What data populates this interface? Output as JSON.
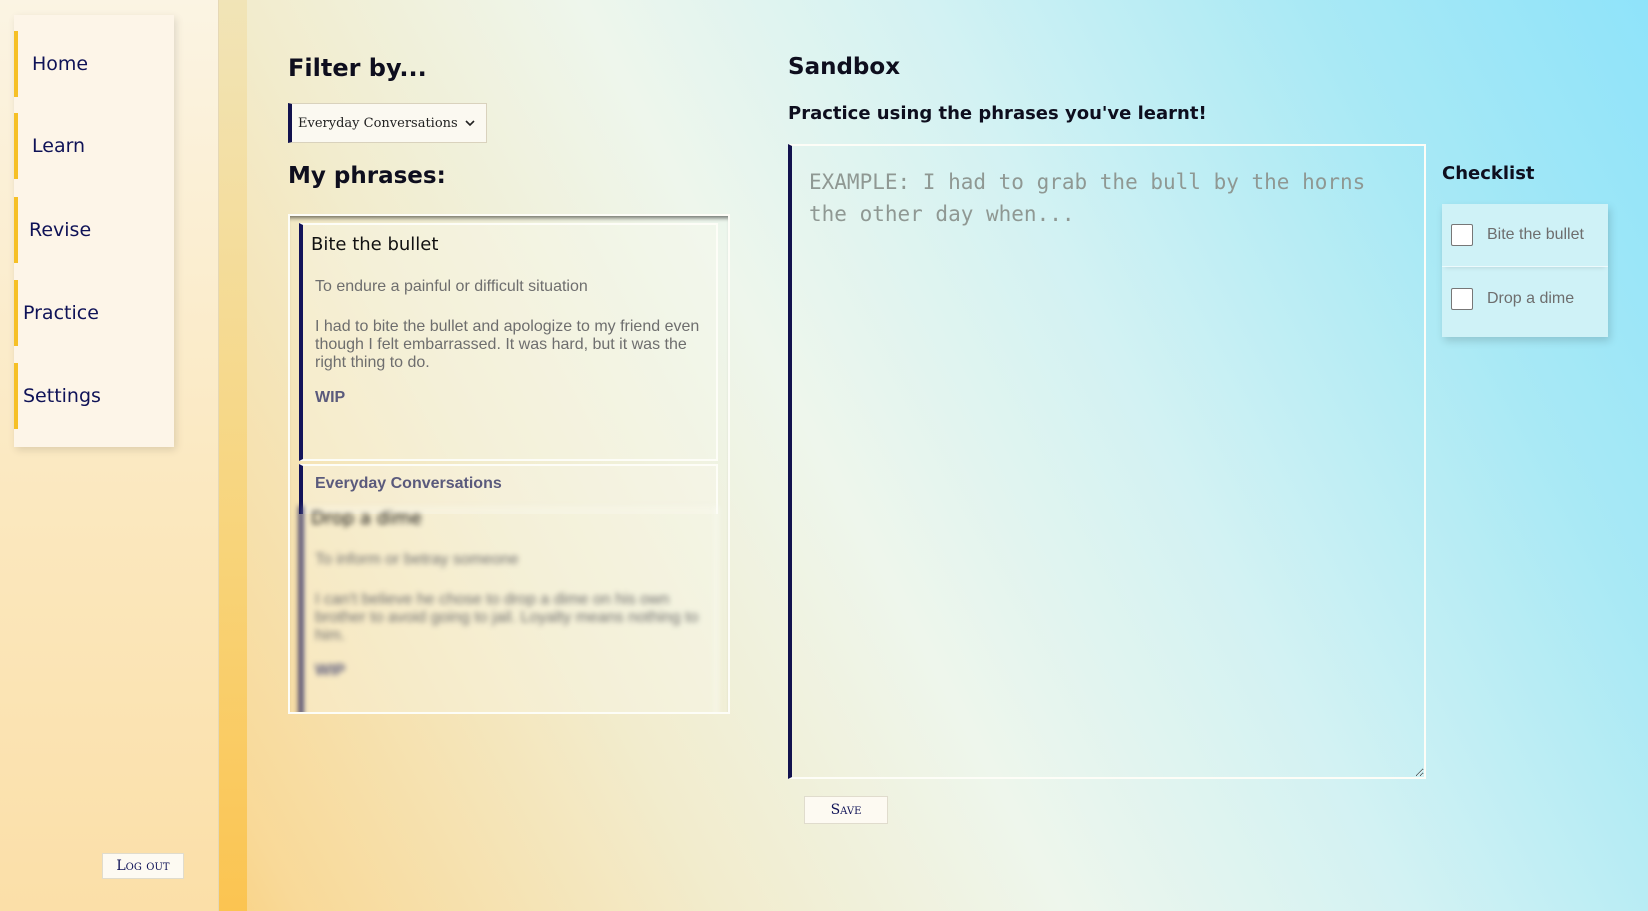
{
  "nav": {
    "items": [
      {
        "label": "Home"
      },
      {
        "label": "Learn"
      },
      {
        "label": "Revise"
      },
      {
        "label": "Practice"
      },
      {
        "label": "Settings"
      }
    ],
    "logout_label": "Log out"
  },
  "filter": {
    "heading": "Filter by...",
    "selected": "Everyday Conversations"
  },
  "phrases": {
    "heading": "My phrases:",
    "items": [
      {
        "title": "Bite the bullet",
        "definition": "To endure a painful or difficult situation",
        "example": "I had to bite the bullet and apologize to my friend even though I felt embarrassed. It was hard, but it was the right thing to do.",
        "status": "WIP",
        "category": "Everyday Conversations"
      },
      {
        "title": "Drop a dime",
        "definition": "To inform or betray someone",
        "example": "I can't believe he chose to drop a dime on his own brother to avoid going to jail. Loyalty means nothing to him.",
        "status": "WIP"
      }
    ]
  },
  "sandbox": {
    "heading": "Sandbox",
    "subheading": "Practice using the phrases you've learnt!",
    "placeholder": "EXAMPLE: I had to grab the bull by the horns the other day when...",
    "value": "",
    "save_label": "Save"
  },
  "checklist": {
    "heading": "Checklist",
    "items": [
      {
        "label": "Bite the bullet",
        "checked": false
      },
      {
        "label": "Drop a dime",
        "checked": false
      }
    ]
  },
  "colors": {
    "accent_navy": "#12124e",
    "accent_yellow": "#f6c026",
    "text_gray": "#6e6e6e"
  }
}
